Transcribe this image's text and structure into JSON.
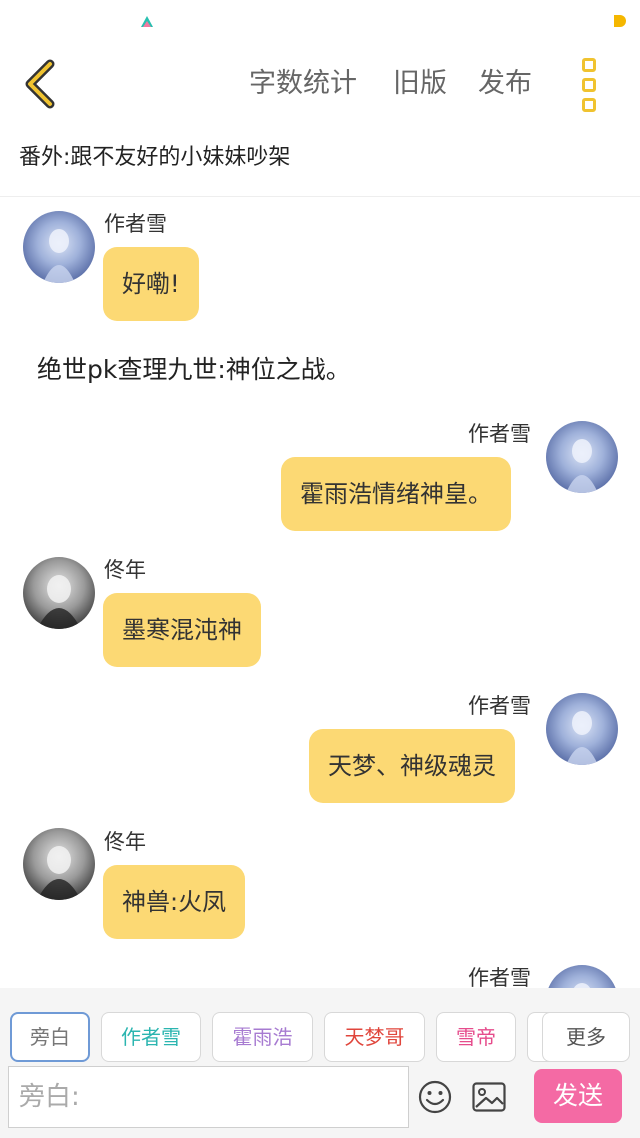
{
  "header": {
    "back_icon": "chevron-left-icon",
    "nav": [
      "字数统计",
      "旧版",
      "发布"
    ],
    "more_icon": "more-vertical-icon",
    "accent_color": "#f0c330"
  },
  "chapter": {
    "title": "番外:跟不友好的小妹妹吵架"
  },
  "messages": [
    {
      "speaker": "作者雪",
      "text": "好嘞!",
      "side": "left",
      "avatar": "avatar-snow"
    },
    {
      "speaker": "作者雪",
      "text": "霍雨浩情绪神皇。",
      "side": "right",
      "avatar": "avatar-snow"
    },
    {
      "speaker": "佟年",
      "text": "墨寒混沌神",
      "side": "left",
      "avatar": "avatar-tongnian"
    },
    {
      "speaker": "作者雪",
      "text": "天梦、神级魂灵",
      "side": "right",
      "avatar": "avatar-snow"
    },
    {
      "speaker": "佟年",
      "text": "神兽:火凤",
      "side": "left",
      "avatar": "avatar-tongnian"
    },
    {
      "speaker": "作者雪",
      "text": "",
      "side": "right",
      "avatar": "avatar-snow"
    }
  ],
  "narration": {
    "text": "绝世pk查理九世:神位之战。"
  },
  "roles": [
    {
      "label": "旁白",
      "color": "#777777"
    },
    {
      "label": "作者雪",
      "color": "#2bb5b0"
    },
    {
      "label": "霍雨浩",
      "color": "#a77bd1"
    },
    {
      "label": "天梦哥",
      "color": "#e0463c"
    },
    {
      "label": "雪帝",
      "color": "#e64c8c"
    },
    {
      "label": "",
      "color": "#999999"
    }
  ],
  "more_label": "更多",
  "composer": {
    "placeholder": "旁白:",
    "emoji_icon": "smiley-icon",
    "image_icon": "image-icon",
    "send_label": "发送",
    "send_color": "#f46aa4"
  },
  "bubble_color": "#fcd974"
}
